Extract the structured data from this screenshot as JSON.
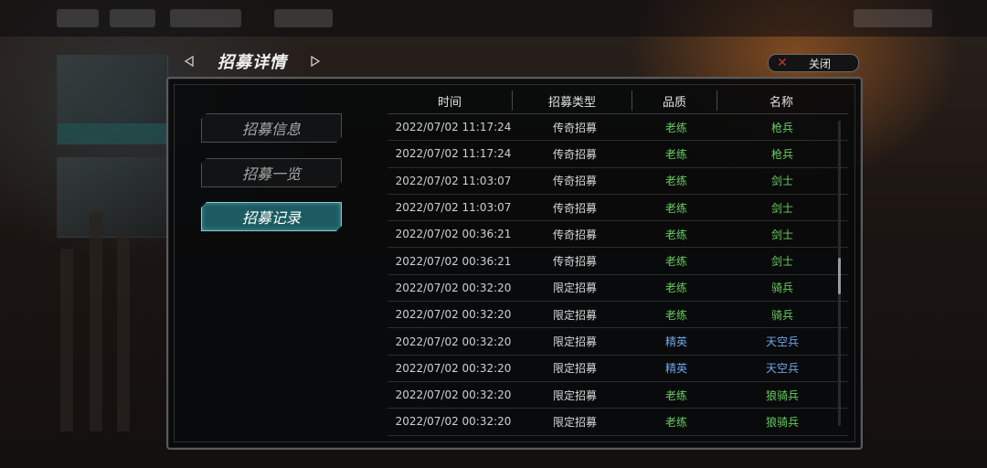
{
  "header": {
    "title": "招募详情",
    "close_label": "关闭",
    "icons": {
      "prev": "triangle-left-icon",
      "next": "triangle-right-icon",
      "close": "red-x-icon"
    }
  },
  "sidebar": {
    "items": [
      {
        "label": "招募信息",
        "active": false
      },
      {
        "label": "招募一览",
        "active": false
      },
      {
        "label": "招募记录",
        "active": true
      }
    ]
  },
  "table": {
    "columns": [
      "时间",
      "招募类型",
      "品质",
      "名称"
    ],
    "rows": [
      {
        "time": "2022/07/02 11:17:24",
        "type": "传奇招募",
        "quality": "老练",
        "name": "枪兵",
        "color": "#67d05e"
      },
      {
        "time": "2022/07/02 11:17:24",
        "type": "传奇招募",
        "quality": "老练",
        "name": "枪兵",
        "color": "#67d05e"
      },
      {
        "time": "2022/07/02 11:03:07",
        "type": "传奇招募",
        "quality": "老练",
        "name": "剑士",
        "color": "#67d05e"
      },
      {
        "time": "2022/07/02 11:03:07",
        "type": "传奇招募",
        "quality": "老练",
        "name": "剑士",
        "color": "#67d05e"
      },
      {
        "time": "2022/07/02 00:36:21",
        "type": "传奇招募",
        "quality": "老练",
        "name": "剑士",
        "color": "#67d05e"
      },
      {
        "time": "2022/07/02 00:36:21",
        "type": "传奇招募",
        "quality": "老练",
        "name": "剑士",
        "color": "#67d05e"
      },
      {
        "time": "2022/07/02 00:32:20",
        "type": "限定招募",
        "quality": "老练",
        "name": "骑兵",
        "color": "#67d05e"
      },
      {
        "time": "2022/07/02 00:32:20",
        "type": "限定招募",
        "quality": "老练",
        "name": "骑兵",
        "color": "#67d05e"
      },
      {
        "time": "2022/07/02 00:32:20",
        "type": "限定招募",
        "quality": "精英",
        "name": "天空兵",
        "color": "#6fa7e8"
      },
      {
        "time": "2022/07/02 00:32:20",
        "type": "限定招募",
        "quality": "精英",
        "name": "天空兵",
        "color": "#6fa7e8"
      },
      {
        "time": "2022/07/02 00:32:20",
        "type": "限定招募",
        "quality": "老练",
        "name": "狼骑兵",
        "color": "#67d05e"
      },
      {
        "time": "2022/07/02 00:32:20",
        "type": "限定招募",
        "quality": "老练",
        "name": "狼骑兵",
        "color": "#67d05e"
      }
    ]
  },
  "colors": {
    "accent": "#1c5b62",
    "green_quality": "#67d05e",
    "blue_quality": "#6fa7e8",
    "close_x": "#c8332b"
  }
}
